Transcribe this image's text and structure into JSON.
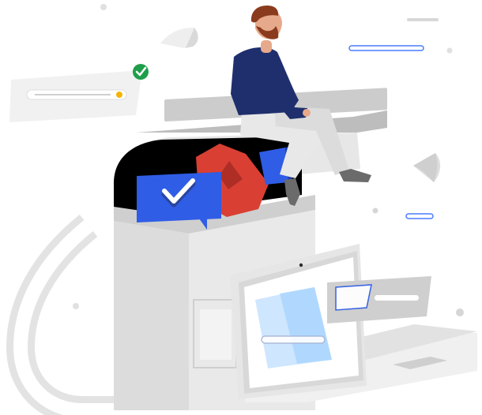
{
  "scene": {
    "kind": "illustration",
    "elements": [
      "man-sitting-icon",
      "mailbox-icon",
      "envelope-check-icon",
      "laptop-icon",
      "check-circle-icon",
      "floating-card-icon",
      "paper-scraps-icon",
      "pipe-icon"
    ]
  },
  "colors": {
    "background": "#ffffff",
    "accent_blue": "#2f5de6",
    "navy": "#1f2f6e",
    "red": "#d93f33",
    "green": "#1e9e4a",
    "yellow": "#f4b400",
    "gray_light": "#f1f1f1",
    "gray_mid": "#d7d7d7",
    "gray_dark": "#8e8e8e",
    "black": "#000000",
    "skin": "#e7a98b",
    "hair": "#8b3b1d",
    "pants": "#e8e8e8",
    "shoes": "#6b6b6b",
    "screen_blue": "#cfe6ff"
  }
}
